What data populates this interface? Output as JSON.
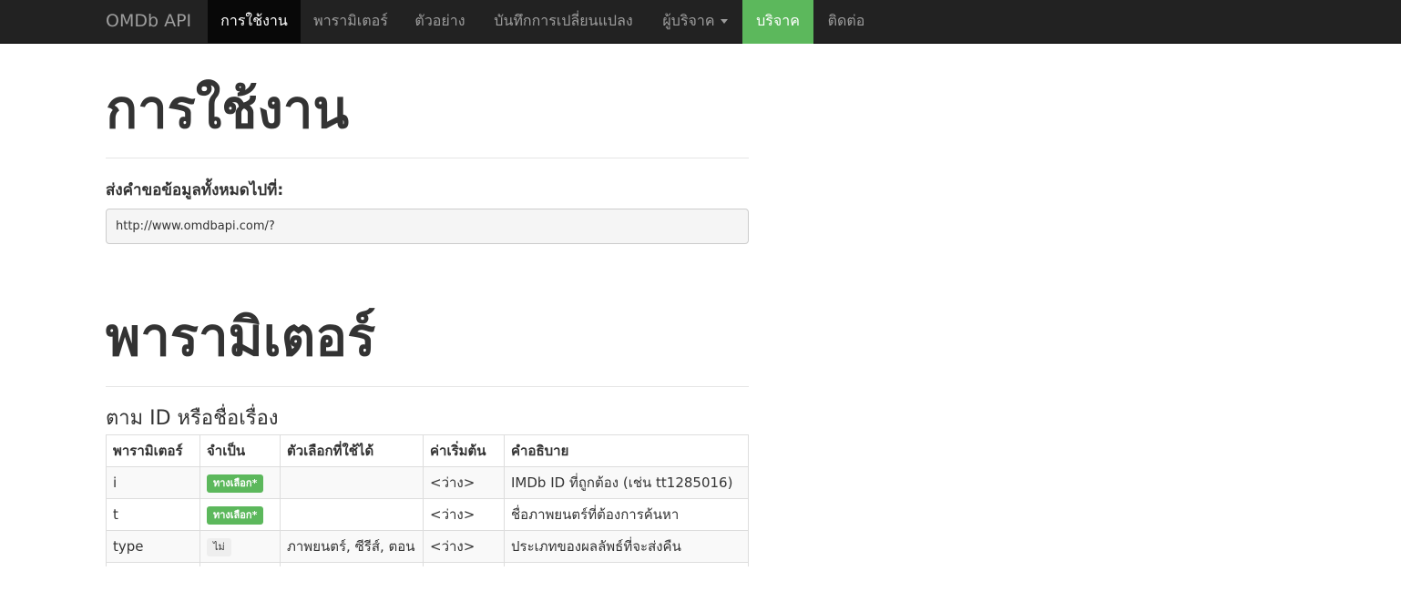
{
  "navbar": {
    "brand": "OMDb API",
    "items": [
      {
        "label": "การใช้งาน",
        "active": true
      },
      {
        "label": "พารามิเตอร์"
      },
      {
        "label": "ตัวอย่าง"
      },
      {
        "label": "บันทึกการเปลี่ยนแปลง"
      },
      {
        "label": "ผู้บริจาค",
        "dropdown": true
      },
      {
        "label": "บริจาค",
        "highlight": true
      },
      {
        "label": "ติดต่อ"
      }
    ]
  },
  "usage": {
    "title": "การใช้งาน",
    "send_label": "ส่งคำขอข้อมูลทั้งหมดไปที่:",
    "url": "http://www.omdbapi.com/?"
  },
  "parameters": {
    "title": "พารามิเตอร์",
    "subtitle": "ตาม ID หรือชื่อเรื่อง",
    "columns": [
      "พารามิเตอร์",
      "จำเป็น",
      "ตัวเลือกที่ใช้ได้",
      "ค่าเริ่มต้น",
      "คำอธิบาย"
    ],
    "rows": [
      {
        "param": "i",
        "required": "ทางเลือก*",
        "required_style": "success",
        "options": "",
        "default": "<ว่าง>",
        "description": "IMDb ID ที่ถูกต้อง (เช่น tt1285016)"
      },
      {
        "param": "t",
        "required": "ทางเลือก*",
        "required_style": "success",
        "options": "",
        "default": "<ว่าง>",
        "description": "ชื่อภาพยนตร์ที่ต้องการค้นหา"
      },
      {
        "param": "type",
        "required": "ไม่",
        "required_style": "default",
        "options": "ภาพยนตร์, ซีรีส์, ตอน",
        "default": "<ว่าง>",
        "description": "ประเภทของผลลัพธ์ที่จะส่งคืน"
      }
    ]
  },
  "colors": {
    "navbar_bg": "#222222",
    "active_bg": "#080808",
    "donate_bg": "#5cb85c",
    "badge_success": "#5cb85c",
    "badge_default": "#eeeeee"
  }
}
